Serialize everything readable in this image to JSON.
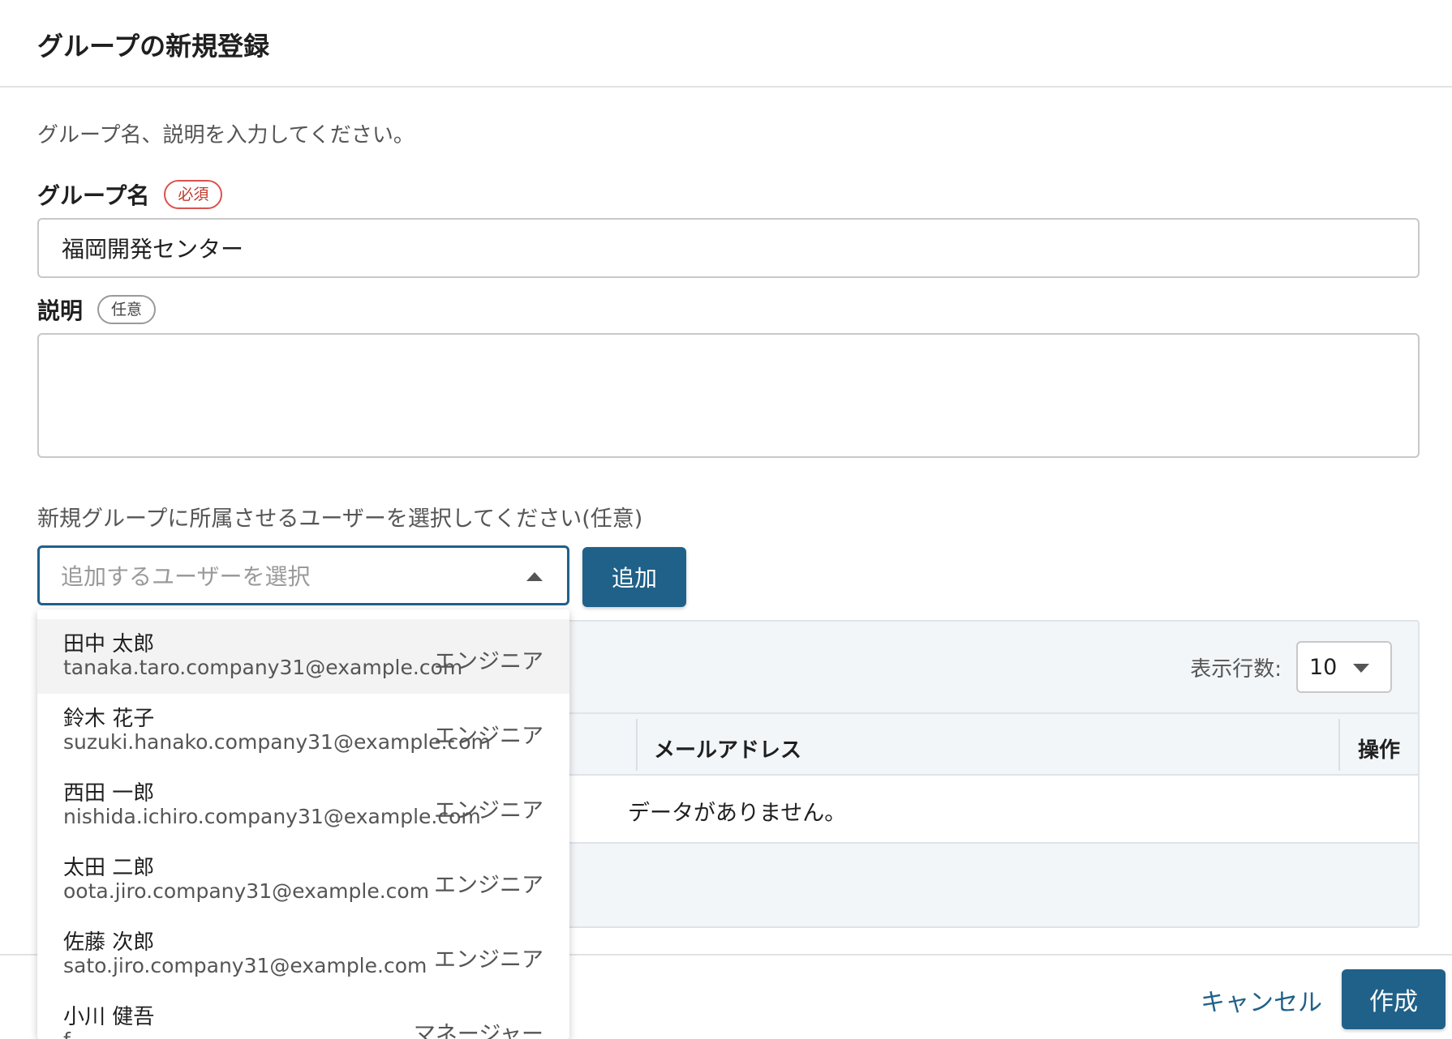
{
  "header": {
    "title": "グループの新規登録"
  },
  "form": {
    "intro": "グループ名、説明を入力してください。",
    "name_label": "グループ名",
    "required_badge": "必須",
    "name_value": "福岡開発センター",
    "desc_label": "説明",
    "optional_badge": "任意",
    "desc_value": ""
  },
  "assign": {
    "text": "新規グループに所属させるユーザーを選択してください(任意)",
    "select_placeholder": "追加するユーザーを選択",
    "add_button": "追加"
  },
  "dropdown": {
    "options": [
      {
        "name": "田中 太郎",
        "email": "tanaka.taro.company31@example.com",
        "role": "エンジニア"
      },
      {
        "name": "鈴木 花子",
        "email": "suzuki.hanako.company31@example.com",
        "role": "エンジニア"
      },
      {
        "name": "西田 一郎",
        "email": "nishida.ichiro.company31@example.com",
        "role": "エンジニア"
      },
      {
        "name": "太田 二郎",
        "email": "oota.jiro.company31@example.com",
        "role": "エンジニア"
      },
      {
        "name": "佐藤 次郎",
        "email": "sato.jiro.company31@example.com",
        "role": "エンジニア"
      },
      {
        "name": "小川 健吾",
        "email": "f...",
        "role": "マネージャー"
      }
    ]
  },
  "table": {
    "rows_per_page_label": "表示行数:",
    "rows_per_page_value": "10",
    "col_email": "メールアドレス",
    "col_action": "操作",
    "empty_message": "データがありません。"
  },
  "footer": {
    "cancel": "キャンセル",
    "create": "作成"
  },
  "colors": {
    "primary": "#1f6189",
    "required": "#d9534f"
  }
}
